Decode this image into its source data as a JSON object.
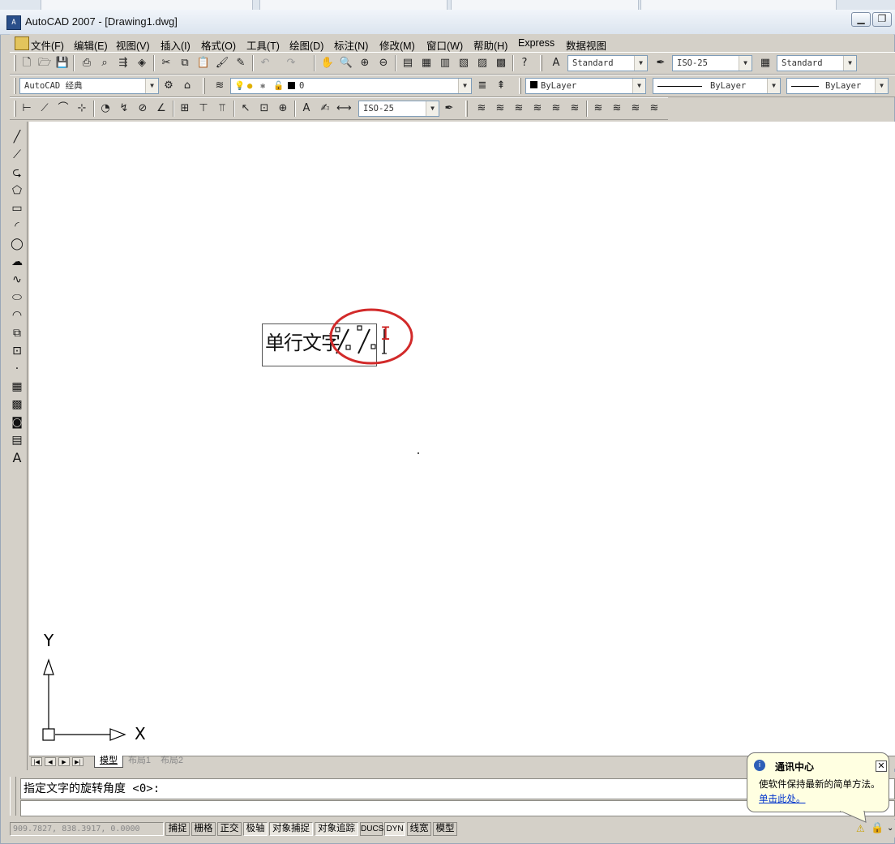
{
  "window": {
    "title": "AutoCAD 2007 - [Drawing1.dwg]",
    "minimize_glyph": "▁",
    "restore_glyph": "❐"
  },
  "menu": [
    "文件(F)",
    "编辑(E)",
    "视图(V)",
    "插入(I)",
    "格式(O)",
    "工具(T)",
    "绘图(D)",
    "标注(N)",
    "修改(M)",
    "窗口(W)",
    "帮助(H)",
    "Express",
    "数据视图"
  ],
  "toolbar_styles": {
    "text_style": "Standard",
    "dim_style": "ISO-25",
    "table_style": "Standard"
  },
  "toolbar_layers": {
    "workspace": "AutoCAD 经典",
    "layer": "0",
    "color": "ByLayer",
    "linetype": "ByLayer",
    "lineweight": "ByLayer"
  },
  "toolbar_dim": {
    "dim_style": "ISO-25"
  },
  "drawing": {
    "text_content": "单行文字",
    "special_chars": "%%",
    "cursor_glyph": "I",
    "ucs_y": "Y",
    "ucs_x": "X"
  },
  "layout_tabs": [
    "模型",
    "布局1",
    "布局2"
  ],
  "command": {
    "prompt": "指定文字的旋转角度 <0>:"
  },
  "status": {
    "coords": "909.7827,  838.3917, 0.0000",
    "buttons": [
      "捕捉",
      "栅格",
      "正交",
      "极轴",
      "对象捕捉",
      "对象追踪",
      "DUCS",
      "DYN",
      "线宽",
      "模型"
    ]
  },
  "balloon": {
    "title": "通讯中心",
    "message": "使软件保持最新的简单方法。",
    "link": "单击此处。"
  },
  "colors": {
    "highlight_circle": "#d22a2a",
    "chrome": "#d4d0c8",
    "canvas": "#ffffff"
  }
}
